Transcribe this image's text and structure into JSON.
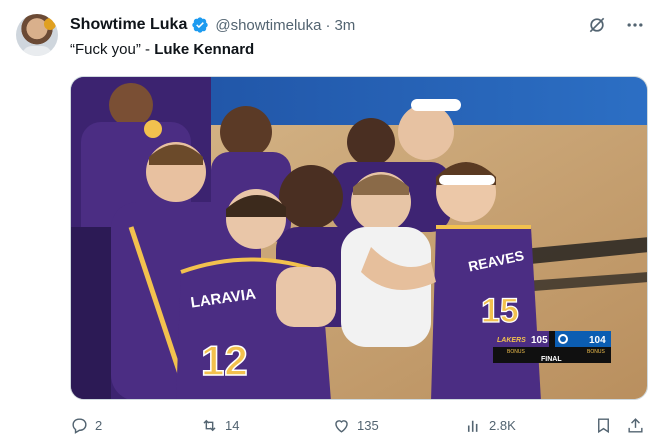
{
  "post": {
    "author_name": "Showtime Luka",
    "author_handle": "@showtimeluka",
    "separator": "·",
    "time_ago": "3m",
    "text_quote": "“Fuck you”",
    "text_dash": " - ",
    "text_bold": "Luke Kennard"
  },
  "media": {
    "jersey_left_name": "LARAVIA",
    "jersey_left_number": "12",
    "jersey_right_name": "REAVES",
    "jersey_right_number": "15",
    "scorebug": {
      "home_abbr": "LAKERS",
      "home_score": "105",
      "away_score": "104",
      "home_bonus": "BONUS",
      "away_bonus": "BONUS",
      "status": "FINAL"
    }
  },
  "actions": {
    "replies": "2",
    "reposts": "14",
    "likes": "135",
    "views": "2.8K"
  },
  "colors": {
    "verified_blue": "#1d9bf0",
    "lakers_purple": "#4b2d83",
    "lakers_gold": "#f2c14e",
    "text_secondary": "#536471"
  }
}
